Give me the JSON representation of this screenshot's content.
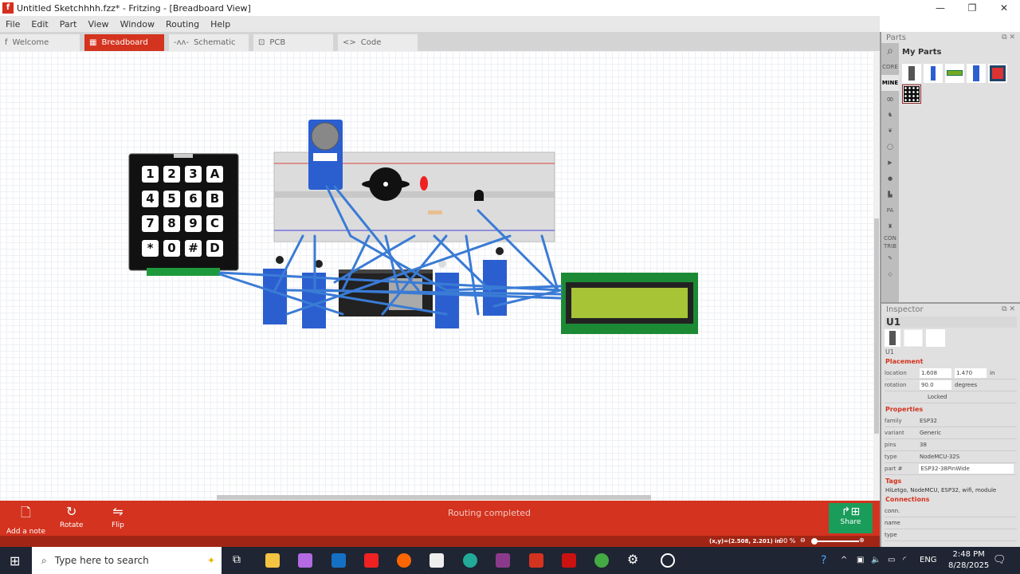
{
  "window": {
    "title": "Untitled Sketchhhh.fzz* - Fritzing - [Breadboard View]",
    "minimize": "—",
    "maximize": "❐",
    "close": "✕"
  },
  "menu": [
    "File",
    "Edit",
    "Part",
    "View",
    "Window",
    "Routing",
    "Help"
  ],
  "tabs": [
    {
      "label": "Welcome",
      "icon": "f"
    },
    {
      "label": "Breadboard",
      "icon": "▦"
    },
    {
      "label": "Schematic",
      "icon": "-ᴧᴧ-"
    },
    {
      "label": "PCB",
      "icon": "⊡"
    },
    {
      "label": "Code",
      "icon": "<>"
    }
  ],
  "canvas": {
    "logo": "fritzing",
    "keypad": [
      "1",
      "2",
      "3",
      "A",
      "4",
      "5",
      "6",
      "B",
      "7",
      "8",
      "9",
      "C",
      "*",
      "0",
      "#",
      "D"
    ]
  },
  "bottom": {
    "add_note": "Add a note",
    "rotate": "Rotate",
    "flip": "Flip",
    "status": "Routing completed",
    "share": "Share"
  },
  "statusbar": {
    "coords": "(x,y)=(2.508, 2.201) in",
    "zoom": "90 %"
  },
  "parts": {
    "title": "Parts",
    "my_parts": "My Parts",
    "bins": [
      "CORE",
      "MINE",
      "CON TRIB"
    ]
  },
  "inspector": {
    "title": "Inspector",
    "part": "U1",
    "caption": "U1",
    "placement": "Placement",
    "location_label": "location",
    "loc_x": "1.608",
    "loc_y": "1.470",
    "loc_unit": "in",
    "rotation_label": "rotation",
    "rotation": "90.0",
    "rotation_unit": "degrees",
    "locked": "Locked",
    "properties": "Properties",
    "props": [
      {
        "k": "family",
        "v": "ESP32"
      },
      {
        "k": "variant",
        "v": "Generic"
      },
      {
        "k": "pins",
        "v": "38"
      },
      {
        "k": "type",
        "v": "NodeMCU-32S"
      }
    ],
    "partnum_label": "part #",
    "partnum": "ESP32-38PinWide",
    "tags_label": "Tags",
    "tags": "HiLetgo, NodeMCU, ESP32, wifi, module",
    "connections": "Connections",
    "conn": [
      "conn.",
      "name",
      "type"
    ]
  },
  "taskbar": {
    "search_placeholder": "Type here to search",
    "lang": "ENG",
    "time": "2:48 PM",
    "date": "8/28/2025"
  },
  "colors": {
    "accent": "#d3331f",
    "share": "#1a9c5b",
    "wire": "#3a7bd5"
  }
}
